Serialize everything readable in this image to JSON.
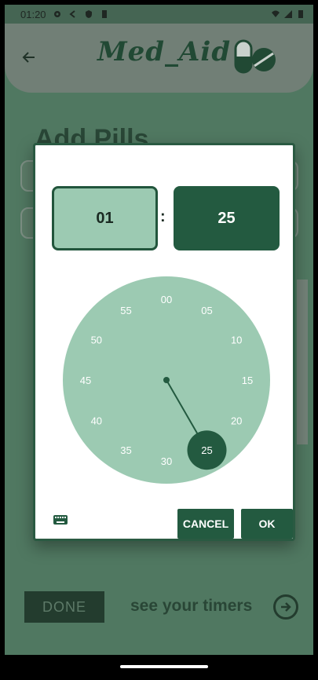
{
  "status_bar": {
    "time": "01:20"
  },
  "app_bar": {
    "title": "Med_Aid",
    "back_icon": "arrow-left-icon",
    "logo_icon": "pill-capsule-icon"
  },
  "page": {
    "heading": "Add Pills",
    "done_label": "DONE",
    "timers_link": "see your timers",
    "timers_icon": "arrow-right-circle-icon"
  },
  "dialog": {
    "hour": "01",
    "separator": ":",
    "minute": "25",
    "selected_minute": 25,
    "clock_numbers": [
      "00",
      "05",
      "10",
      "15",
      "20",
      "25",
      "30",
      "35",
      "40",
      "45",
      "50",
      "55"
    ],
    "keyboard_icon": "keyboard-icon",
    "cancel_label": "CANCEL",
    "ok_label": "OK"
  },
  "colors": {
    "accent": "#235a40",
    "clock_face": "#9ccab2",
    "hour_box": "#9ccab2",
    "page_bg": "#5e8870"
  }
}
